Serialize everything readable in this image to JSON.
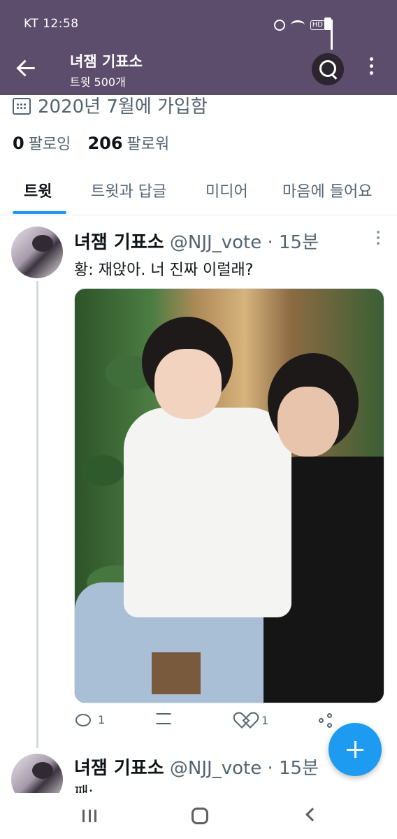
{
  "status_bar": {
    "carrier_time": "KT 12:58",
    "icons": [
      "alarm-icon",
      "wifi-icon",
      "hd-icon",
      "signal-icon",
      "battery-icon"
    ],
    "hd_label": "HD"
  },
  "header": {
    "title": "녀잼 기표소",
    "subtitle": "트윗 500개",
    "background_color": "#5b4d6b"
  },
  "profile": {
    "joined": "2020년 7월에 가입함",
    "following_count": "0",
    "following_label": "팔로잉",
    "followers_count": "206",
    "followers_label": "팔로워"
  },
  "tabs": [
    {
      "label": "트윗",
      "active": true
    },
    {
      "label": "트윗과 답글",
      "active": false
    },
    {
      "label": "미디어",
      "active": false
    },
    {
      "label": "마음에 들어요",
      "active": false
    }
  ],
  "tweets": [
    {
      "name": "녀잼 기표소",
      "handle_time": "@NJJ_vote · 15분",
      "text": "황:  재앉아. 너 진짜 이럴래?",
      "reply_count": "1",
      "like_count": "1"
    },
    {
      "name": "녀잼 기표소",
      "handle_time": "@NJJ_vote · 15분",
      "text": "째:"
    }
  ],
  "accent_color": "#1d9bf0"
}
